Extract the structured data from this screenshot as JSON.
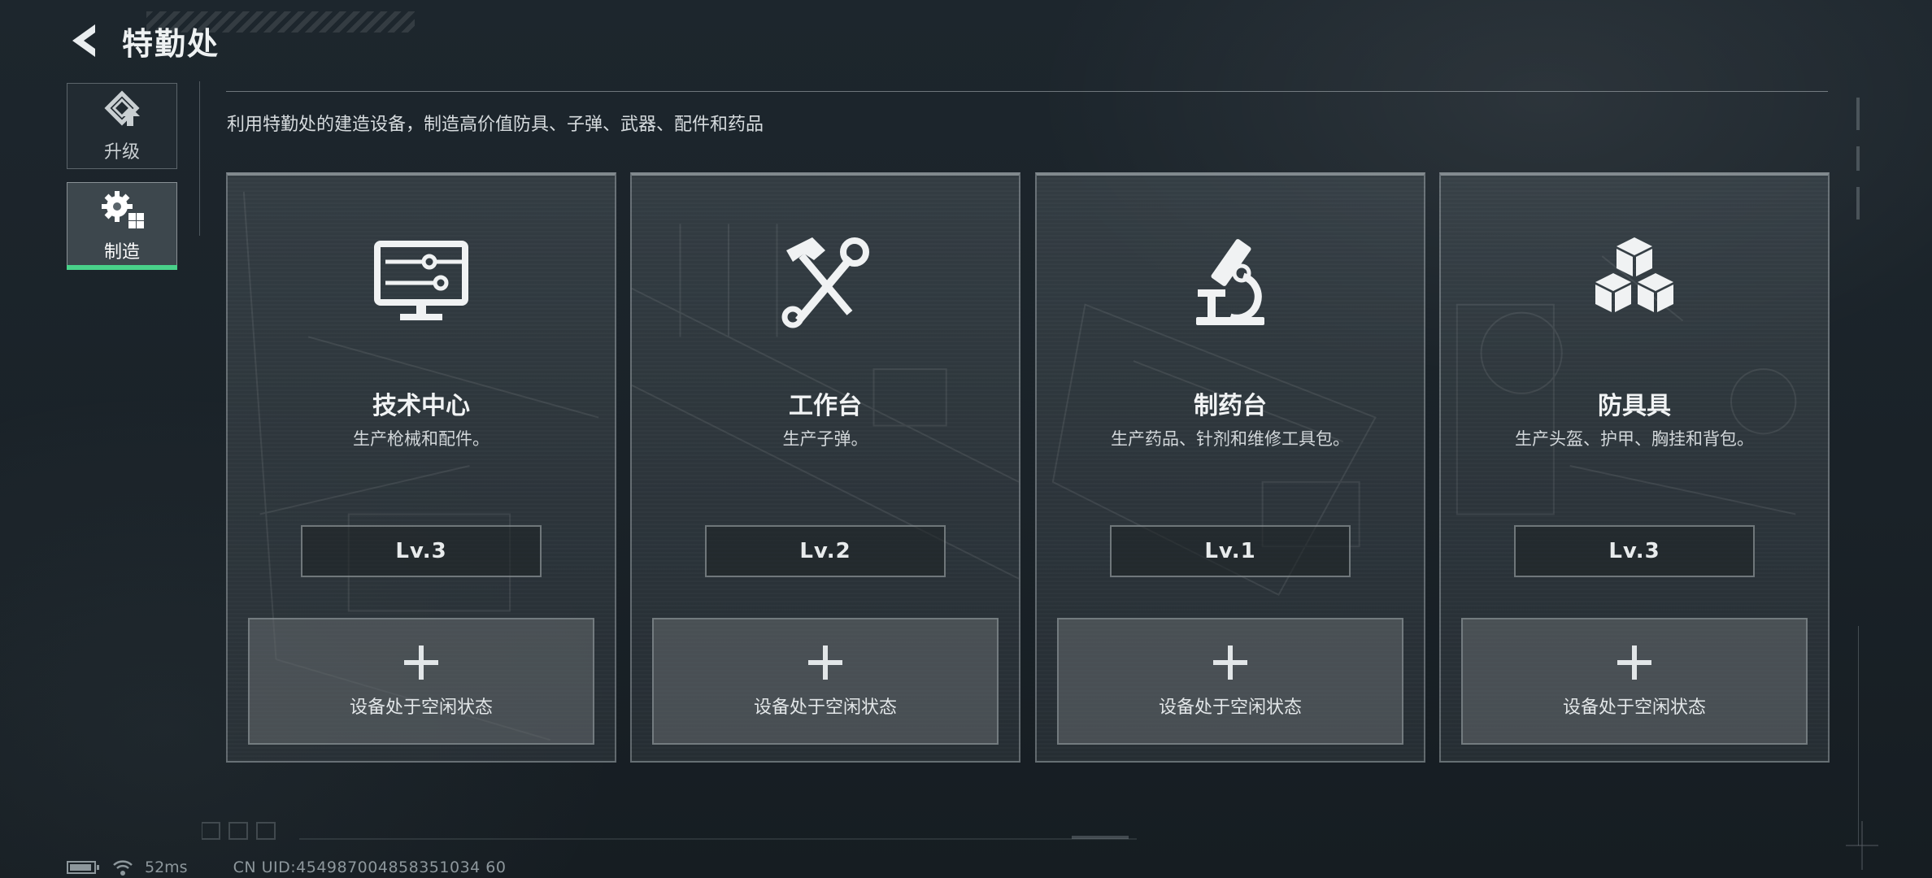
{
  "header": {
    "title": "特勤处",
    "back_icon": "back-arrow-icon"
  },
  "sidebar": {
    "tabs": [
      {
        "label": "升级",
        "icon": "upgrade-icon",
        "active": false
      },
      {
        "label": "制造",
        "icon": "gear-grid-icon",
        "active": true
      }
    ],
    "active_color": "#49d18a"
  },
  "description": "利用特勤处的建造设备，制造高价值防具、子弹、武器、配件和药品",
  "cards": [
    {
      "name": "技术中心",
      "subtitle": "生产枪械和配件。",
      "level": "Lv.3",
      "slot_label": "设备处于空闲状态",
      "icon": "monitor-circuit-icon"
    },
    {
      "name": "工作台",
      "subtitle": "生产子弹。",
      "level": "Lv.2",
      "slot_label": "设备处于空闲状态",
      "icon": "hammer-wrench-icon"
    },
    {
      "name": "制药台",
      "subtitle": "生产药品、针剂和维修工具包。",
      "level": "Lv.1",
      "slot_label": "设备处于空闲状态",
      "icon": "microscope-icon"
    },
    {
      "name": "防具具",
      "subtitle": "生产头盔、护甲、胸挂和背包。",
      "level": "Lv.3",
      "slot_label": "设备处于空闲状态",
      "icon": "cubes-icon"
    }
  ],
  "status": {
    "ping": "52ms",
    "uid": "CN UID:454987004858351034 60"
  }
}
